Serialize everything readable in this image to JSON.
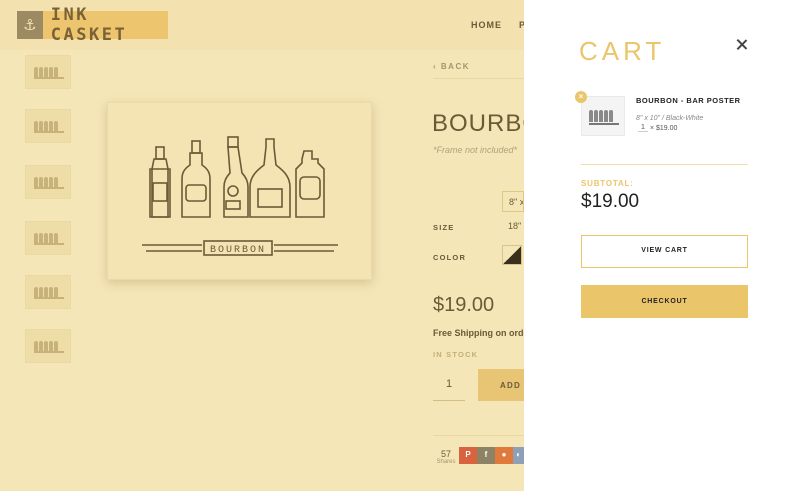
{
  "header": {
    "logo_text": "INK CASKET",
    "nav": {
      "home": "HOME",
      "second_partial": "P"
    }
  },
  "product": {
    "back_label": "BACK",
    "title": "BOURBON",
    "frame_note": "*Frame not included*",
    "size_option_visible": "8\" x",
    "size_label": "SIZE",
    "size_value_visible": "18\"",
    "color_label": "COLOR",
    "price": "$19.00",
    "shipping_text": "Free Shipping on orde",
    "stock_status": "IN STOCK",
    "quantity": "1",
    "add_button_label": "ADD T",
    "poster_caption": "BOURBON",
    "share": {
      "count": "57",
      "label": "Shares"
    }
  },
  "cart": {
    "title": "CART",
    "item": {
      "name": "BOURBON - BAR POSTER",
      "variant": "8\" x 10\" / Black-White",
      "quantity": "1",
      "times": "×",
      "price": "$19.00",
      "remove_glyph": "×"
    },
    "subtotal_label": "SUBTOTAL:",
    "subtotal": "$19.00",
    "view_cart_label": "VIEW CART",
    "checkout_label": "CHECKOUT"
  },
  "colors": {
    "accent": "#ebc56a",
    "overlay_tint": "#f5e6b8",
    "ink": "#6b5a36"
  }
}
